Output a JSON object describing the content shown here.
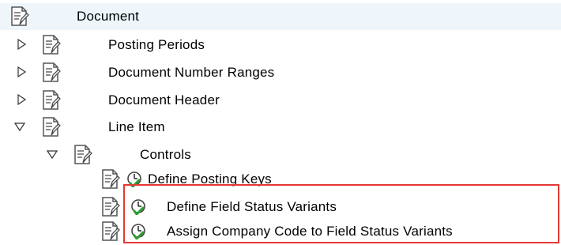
{
  "tree": {
    "root": {
      "label": "Document",
      "icon": "document-icon"
    },
    "items": [
      {
        "label": "Posting Periods",
        "expanded": false,
        "icon": "document-icon"
      },
      {
        "label": "Document Number Ranges",
        "expanded": false,
        "icon": "document-icon"
      },
      {
        "label": "Document Header",
        "expanded": false,
        "icon": "document-icon"
      },
      {
        "label": "Line Item",
        "expanded": true,
        "icon": "document-icon"
      }
    ],
    "controls": {
      "label": "Controls",
      "expanded": true,
      "icon": "document-icon"
    },
    "activities": [
      {
        "label": "Define Posting Keys",
        "icons": [
          "document-icon",
          "execute-clock-icon"
        ]
      },
      {
        "label": "Define Field Status Variants",
        "icons": [
          "document-icon",
          "execute-clock-icon"
        ]
      },
      {
        "label": "Assign Company Code to Field Status Variants",
        "icons": [
          "document-icon",
          "execute-clock-icon"
        ]
      }
    ]
  },
  "colors": {
    "header_bg": "#eef6fb",
    "highlight_border": "#e53935",
    "execute_icon_green": "#2e9e2e"
  }
}
